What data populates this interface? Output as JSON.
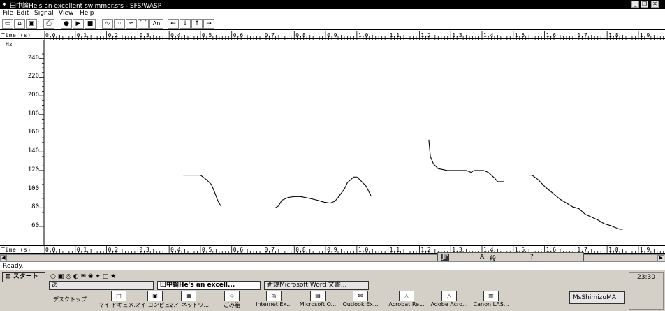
{
  "window": {
    "title": "田中論He's an excellent swimmer.sfs - SFS/WASP",
    "controls": [
      "_",
      "8",
      "x"
    ]
  },
  "menu": {
    "file": "File",
    "edit": "Edit",
    "signal": "Signal",
    "view": "View",
    "help": "Help"
  },
  "toolbar": {
    "buttons": [
      "new",
      "open",
      "save",
      "print",
      "record",
      "play",
      "stop",
      "waveform",
      "spectrogram",
      "formant",
      "pitch",
      "annotate",
      "left",
      "down",
      "up",
      "right"
    ],
    "annotate_label": "An"
  },
  "time_axis": {
    "label": "Time (s)",
    "ticks": [
      "0.0",
      "0.1",
      "0.2",
      "0.3",
      "0.4",
      "0.5",
      "0.6",
      "0.7",
      "0.8",
      "0.9",
      "1.0",
      "1.1",
      "1.2",
      "1.3",
      "1.4",
      "1.5",
      "1.6",
      "1.7",
      "1.8",
      "1.9"
    ]
  },
  "chart_data": {
    "type": "line",
    "ylabel": "Hz",
    "xlabel": "Time (s)",
    "ylim": [
      50,
      248
    ],
    "xlim": [
      0.0,
      1.985
    ],
    "yticks": [
      60,
      80,
      100,
      120,
      140,
      160,
      180,
      200,
      220,
      240
    ],
    "series": [
      {
        "x": [
          0.445,
          0.46,
          0.48,
          0.5,
          0.52,
          0.535,
          0.545,
          0.555,
          0.565
        ],
        "y": [
          115,
          115,
          115,
          115,
          110,
          105,
          97,
          88,
          82
        ]
      },
      {
        "x": [
          0.74,
          0.75,
          0.76,
          0.78,
          0.8,
          0.82,
          0.85,
          0.875,
          0.895,
          0.915,
          0.93,
          0.94,
          0.96,
          0.97,
          0.98,
          0.99,
          1.0,
          1.01,
          1.03,
          1.045
        ],
        "y": [
          80,
          82,
          88,
          91,
          92,
          92,
          90,
          88,
          86,
          85,
          87,
          91,
          100,
          107,
          110,
          113,
          113,
          110,
          103,
          93
        ]
      },
      {
        "x": [
          1.23,
          1.235,
          1.245,
          1.26,
          1.29,
          1.32,
          1.35,
          1.365,
          1.375,
          1.39,
          1.405,
          1.42,
          1.43,
          1.44,
          1.45,
          1.47
        ],
        "y": [
          153,
          135,
          127,
          122,
          120,
          120,
          120,
          118,
          120,
          120,
          120,
          118,
          115,
          112,
          108,
          108
        ]
      },
      {
        "x": [
          1.55,
          1.56,
          1.58,
          1.6,
          1.625,
          1.65,
          1.67,
          1.69,
          1.71,
          1.73,
          1.75,
          1.77,
          1.79,
          1.81,
          1.825,
          1.84,
          1.85
        ],
        "y": [
          115,
          115,
          110,
          103,
          96,
          89,
          85,
          81,
          79,
          73,
          70,
          67,
          63,
          61,
          59,
          57,
          57
        ]
      }
    ]
  },
  "status": {
    "ready": "Ready."
  },
  "ime": {
    "labels": [
      "JP",
      "A",
      "般",
      "?"
    ]
  },
  "taskbar": {
    "start": "スタート",
    "tasks": [
      "あ",
      "田中論He's an excell...",
      "新規Microsoft Word 文書..."
    ],
    "desktop_label": "デスクトップ",
    "icons": [
      "マイ ドキュメ...",
      "マイ コンピュ...",
      "マイ ネットワ...",
      "ごみ箱",
      "Internet Ex...",
      "Microsoft O...",
      "Outlook Ex...",
      "Acrobat Re...",
      "Adobe Acro...",
      "Canon LAS..."
    ],
    "user": "MsShimizuMA",
    "clock": "23:30"
  }
}
